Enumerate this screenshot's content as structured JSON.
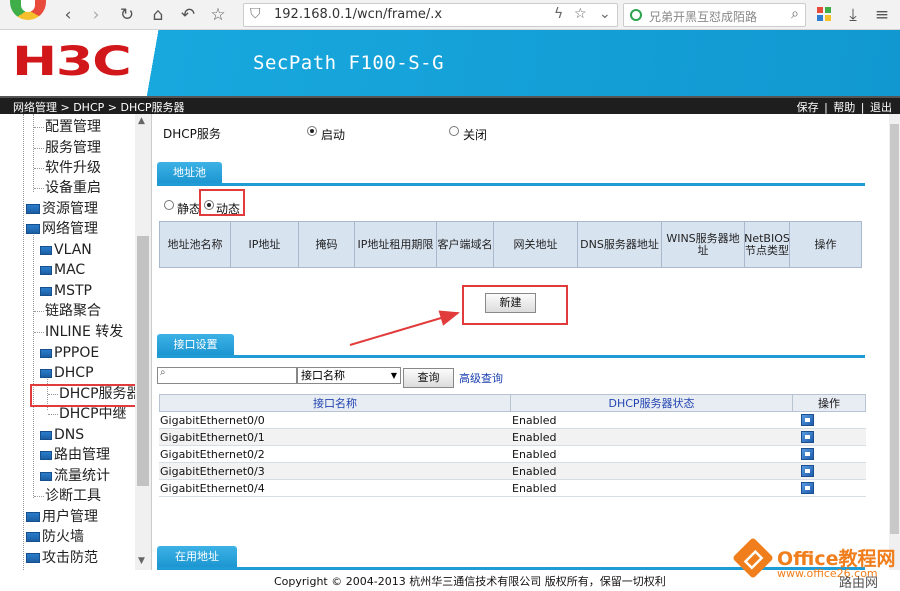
{
  "browser": {
    "url": "192.168.0.1/wcn/frame/.x",
    "search_placeholder": "兄弟开黑互怼成陌路"
  },
  "header": {
    "logo_text": "H3C",
    "device_name": "SecPath F100-S-G",
    "breadcrumb": "网络管理 > DHCP > DHCP服务器",
    "links": [
      "保存",
      "帮助",
      "退出"
    ],
    "brand_red": "#d2171a",
    "brand_blue": "#18a8de"
  },
  "tree": {
    "items": [
      {
        "label": "配置管理"
      },
      {
        "label": "服务管理"
      },
      {
        "label": "软件升级"
      },
      {
        "label": "设备重启"
      },
      {
        "label": "资源管理"
      },
      {
        "label": "网络管理"
      },
      {
        "label": "VLAN"
      },
      {
        "label": "MAC"
      },
      {
        "label": "MSTP"
      },
      {
        "label": "链路聚合"
      },
      {
        "label": "INLINE 转发"
      },
      {
        "label": "PPPOE"
      },
      {
        "label": "DHCP"
      },
      {
        "label": "DHCP服务器"
      },
      {
        "label": "DHCP中继"
      },
      {
        "label": "DNS"
      },
      {
        "label": "路由管理"
      },
      {
        "label": "流量统计"
      },
      {
        "label": "诊断工具"
      },
      {
        "label": "用户管理"
      },
      {
        "label": "防火墙"
      },
      {
        "label": "攻击防范"
      }
    ]
  },
  "main": {
    "dhcp_service_label": "DHCP服务",
    "enable_label": "启动",
    "disable_label": "关闭",
    "pool_tab": "地址池",
    "static_label": "静态",
    "dynamic_label": "动态",
    "pool_columns": [
      "地址池名称",
      "IP地址",
      "掩码",
      "IP地址租用期限",
      "客户端域名",
      "网关地址",
      "DNS服务器地址",
      "WINS服务器地址",
      "NetBIOS节点类型",
      "操作"
    ],
    "new_button": "新建",
    "interface_tab": "接口设置",
    "search_input_value": "",
    "filter_selected": "接口名称",
    "query_button": "查询",
    "advanced_query": "高级查询",
    "interface_columns": [
      "接口名称",
      "DHCP服务器状态",
      "操作"
    ],
    "interfaces": [
      {
        "name": "GigabitEthernet0/0",
        "status": "Enabled"
      },
      {
        "name": "GigabitEthernet0/1",
        "status": "Enabled"
      },
      {
        "name": "GigabitEthernet0/2",
        "status": "Enabled"
      },
      {
        "name": "GigabitEthernet0/3",
        "status": "Enabled"
      },
      {
        "name": "GigabitEthernet0/4",
        "status": "Enabled"
      }
    ],
    "in_use_tab": "在用地址"
  },
  "footer": {
    "copyright": "Copyright © 2004-2013 杭州华三通信技术有限公司 版权所有，保留一切权利"
  },
  "watermark": {
    "title": "Office教程网",
    "url": "www.office26.com",
    "sub": "路由网"
  }
}
